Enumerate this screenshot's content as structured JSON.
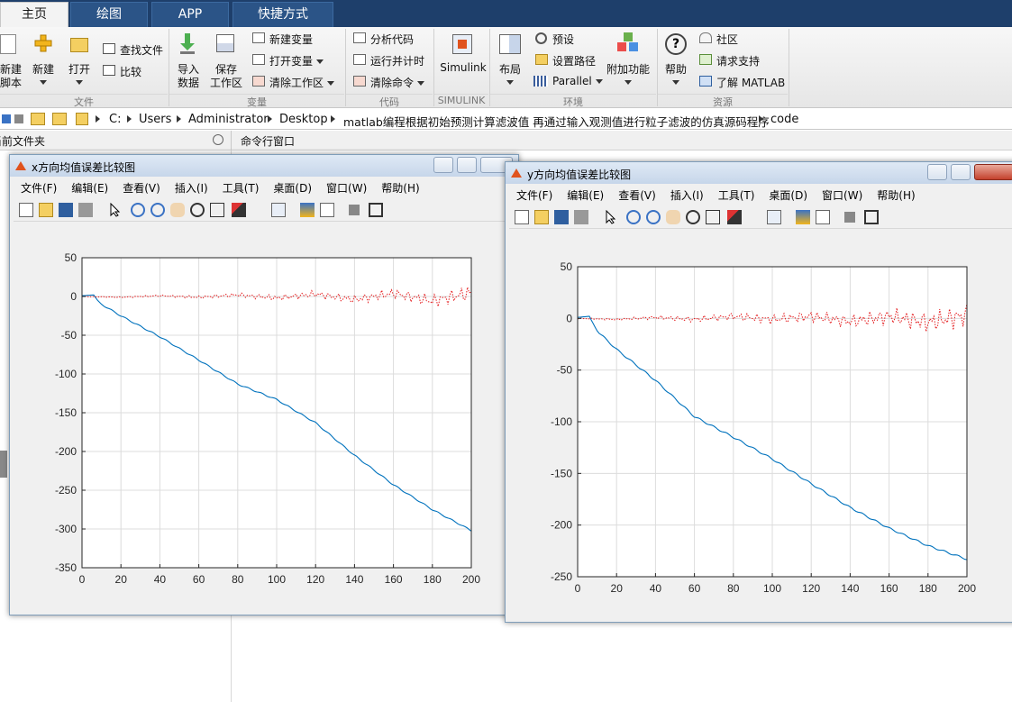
{
  "tabs": [
    "主页",
    "绘图",
    "APP",
    "快捷方式"
  ],
  "ribbon": {
    "new_script": [
      "新建",
      "脚本"
    ],
    "new": "新建",
    "open": "打开",
    "find_files": "查找文件",
    "compare": "比较",
    "import": [
      "导入",
      "数据"
    ],
    "save_ws": [
      "保存",
      "工作区"
    ],
    "new_var": "新建变量",
    "open_var": "打开变量",
    "clear_ws": "清除工作区",
    "analyze_code": "分析代码",
    "run_time": "运行并计时",
    "clear_cmd": "清除命令",
    "simulink": "Simulink",
    "layout": "布局",
    "preferences": "预设",
    "set_path": "设置路径",
    "parallel": "Parallel",
    "addons": "附加功能",
    "help": "帮助",
    "community": "社区",
    "support": "请求支持",
    "learn": "了解 MATLAB",
    "groups": [
      "文件",
      "变量",
      "代码",
      "SIMULINK",
      "环境",
      "资源"
    ]
  },
  "address": [
    "C:",
    "Users",
    "Administrator",
    "Desktop",
    "matlab编程根据初始预测计算滤波值 再通过输入观测值进行粒子滤波的仿真源码程序",
    "code"
  ],
  "panels": {
    "current_folder": "当前文件夹",
    "command_window": "命令行窗口"
  },
  "fig_menu": [
    "文件(F)",
    "编辑(E)",
    "查看(V)",
    "插入(I)",
    "工具(T)",
    "桌面(D)",
    "窗口(W)",
    "帮助(H)"
  ],
  "figures": [
    {
      "title": "x方向均值误差比较图"
    },
    {
      "title": "y方向均值误差比较图"
    }
  ],
  "colors": {
    "blue": "#0072bd",
    "red": "#e41a1c",
    "tab_bg": "#1e3f6b"
  },
  "chart_data": [
    {
      "type": "line",
      "title": "",
      "xlabel": "",
      "ylabel": "",
      "xlim": [
        0,
        200
      ],
      "ylim": [
        -350,
        50
      ],
      "xticks": [
        0,
        20,
        40,
        60,
        80,
        100,
        120,
        140,
        160,
        180,
        200
      ],
      "yticks": [
        50,
        0,
        -50,
        -100,
        -150,
        -200,
        -250,
        -300,
        -350
      ],
      "grid": true,
      "series": [
        {
          "style": "solid",
          "color": "blue",
          "x": [
            0,
            6,
            8,
            10,
            20,
            40,
            60,
            80,
            100,
            120,
            140,
            160,
            180,
            200
          ],
          "values": [
            1,
            2,
            -5,
            -10,
            -25,
            -52,
            -82,
            -113,
            -133,
            -163,
            -205,
            -243,
            -275,
            -302
          ]
        },
        {
          "style": "dotted",
          "color": "red",
          "x": [
            0,
            20,
            40,
            60,
            80,
            100,
            120,
            140,
            160,
            180,
            200
          ],
          "values": [
            0,
            -1,
            1,
            -1,
            2,
            -2,
            3,
            -4,
            4,
            -6,
            5
          ],
          "amplitude": [
            0.5,
            0.8,
            1.5,
            2,
            3,
            4,
            5,
            6,
            7,
            9,
            12
          ]
        }
      ]
    },
    {
      "type": "line",
      "title": "",
      "xlabel": "",
      "ylabel": "",
      "xlim": [
        0,
        200
      ],
      "ylim": [
        -250,
        50
      ],
      "xticks": [
        0,
        20,
        40,
        60,
        80,
        100,
        120,
        140,
        160,
        180,
        200
      ],
      "yticks": [
        50,
        0,
        -50,
        -100,
        -150,
        -200,
        -250
      ],
      "grid": true,
      "series": [
        {
          "style": "solid",
          "color": "blue",
          "x": [
            0,
            6,
            8,
            10,
            20,
            40,
            60,
            80,
            100,
            120,
            140,
            160,
            180,
            200
          ],
          "values": [
            1,
            2,
            -5,
            -12,
            -30,
            -60,
            -95,
            -115,
            -136,
            -160,
            -183,
            -203,
            -220,
            -233
          ]
        },
        {
          "style": "dotted",
          "color": "red",
          "x": [
            0,
            20,
            40,
            60,
            80,
            100,
            120,
            140,
            160,
            180,
            200
          ],
          "values": [
            0,
            -1,
            1,
            -1,
            2,
            -1,
            2,
            -3,
            2,
            -4,
            3
          ],
          "amplitude": [
            0.5,
            1,
            2,
            3,
            4,
            5,
            6,
            7,
            9,
            11,
            13
          ]
        }
      ]
    }
  ]
}
